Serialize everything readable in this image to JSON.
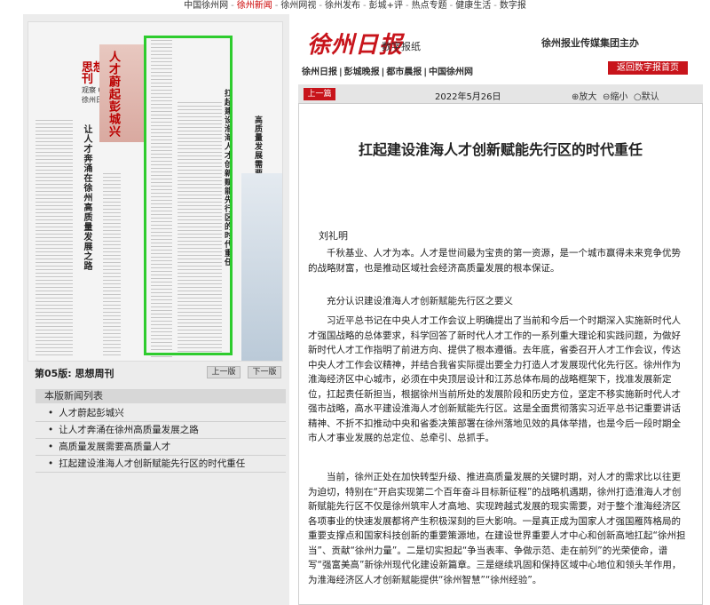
{
  "topnav": {
    "items": [
      "中国徐州网",
      "徐州新闻",
      "徐州网视",
      "徐州发布",
      "彭城+评",
      "热点专题",
      "健康生活",
      "数字报"
    ],
    "active_index": 1,
    "separator": "-"
  },
  "header": {
    "logo": "徐州日报",
    "logo_sub": "数字报纸",
    "group": "徐州报业传媒集团主办",
    "subnav": [
      "徐州日报",
      "彭城晚报",
      "都市晨报",
      "中国徐州网"
    ],
    "subnav_sep": "|",
    "back_button": "返回数字报首页"
  },
  "thumbnail": {
    "masthead": "思想周刊",
    "issue": "观察 05",
    "paper_name": "徐州日报",
    "headlines": [
      "人才蔚起彭城兴",
      "让人才奔涌在徐州高质量发展之路",
      "扛起建设淮海人才创新赋能先行区的时代重任",
      "高质量发展需要高质量人才"
    ]
  },
  "left_panel": {
    "page_label": "第05版:  思想周刊",
    "prev_page": "上一版",
    "next_page": "下一版",
    "news_list_title": "本版新闻列表",
    "news_list": [
      "人才蔚起彭城兴",
      "让人才奔涌在徐州高质量发展之路",
      "高质量发展需要高质量人才",
      "扛起建设淮海人才创新赋能先行区的时代重任"
    ]
  },
  "toolbar": {
    "prev_article": "上一篇",
    "date": "2022年5月26日",
    "zoom_in": "放大",
    "zoom_out": "缩小",
    "zoom_default": "默认"
  },
  "article": {
    "title": "扛起建设淮海人才创新赋能先行区的时代重任",
    "author": "刘礼明",
    "p1": "千秋基业、人才为本。人才是世间最为宝贵的第一资源，是一个城市赢得未来竞争优势的战略财富，也是推动区域社会经济高质量发展的根本保证。",
    "subheading": "充分认识建设淮海人才创新赋能先行区之要义",
    "p2": "习近平总书记在中央人才工作会议上明确提出了当前和今后一个时期深入实施新时代人才强国战略的总体要求，科学回答了新时代人才工作的一系列重大理论和实践问题，为做好新时代人才工作指明了前进方向、提供了根本遵循。去年底，省委召开人才工作会议，传达中央人才工作会议精神，并结合我省实际提出要全力打造人才发展现代化先行区。徐州作为淮海经济区中心城市，必须在中央顶层设计和江苏总体布局的战略框架下，找准发展新定位，扛起责任新担当，根据徐州当前所处的发展阶段和历史方位，坚定不移实施新时代人才强市战略，高水平建设淮海人才创新赋能先行区。这是全面贯彻落实习近平总书记重要讲话精神、不折不扣推动中央和省委决策部署在徐州落地见效的具体举措，也是今后一段时期全市人才事业发展的总定位、总牵引、总抓手。",
    "p3": "当前，徐州正处在加快转型升级、推进高质量发展的关键时期，对人才的需求比以往更为迫切，特别在“开启实现第二个百年奋斗目标新征程”的战略机遇期，徐州打造淮海人才创新赋能先行区不仅是徐州筑牢人才高地、实现跨越式发展的现实需要，对于整个淮海经济区各项事业的快速发展都将产生积极深刻的巨大影响。一是真正成为国家人才强国雁阵格局的重要支撑点和国家科技创新的重要策源地，在建设世界重要人才中心和创新高地扛起“徐州担当”、贡献“徐州力量”。二是切实担起“争当表率、争做示范、走在前列”的光荣使命，谱写“强富美高”新徐州现代化建设新篇章。三是继续巩固和保持区域中心地位和领头羊作用，为淮海经济区人才创新赋能提供“徐州智慧”“徐州经验”。"
  }
}
